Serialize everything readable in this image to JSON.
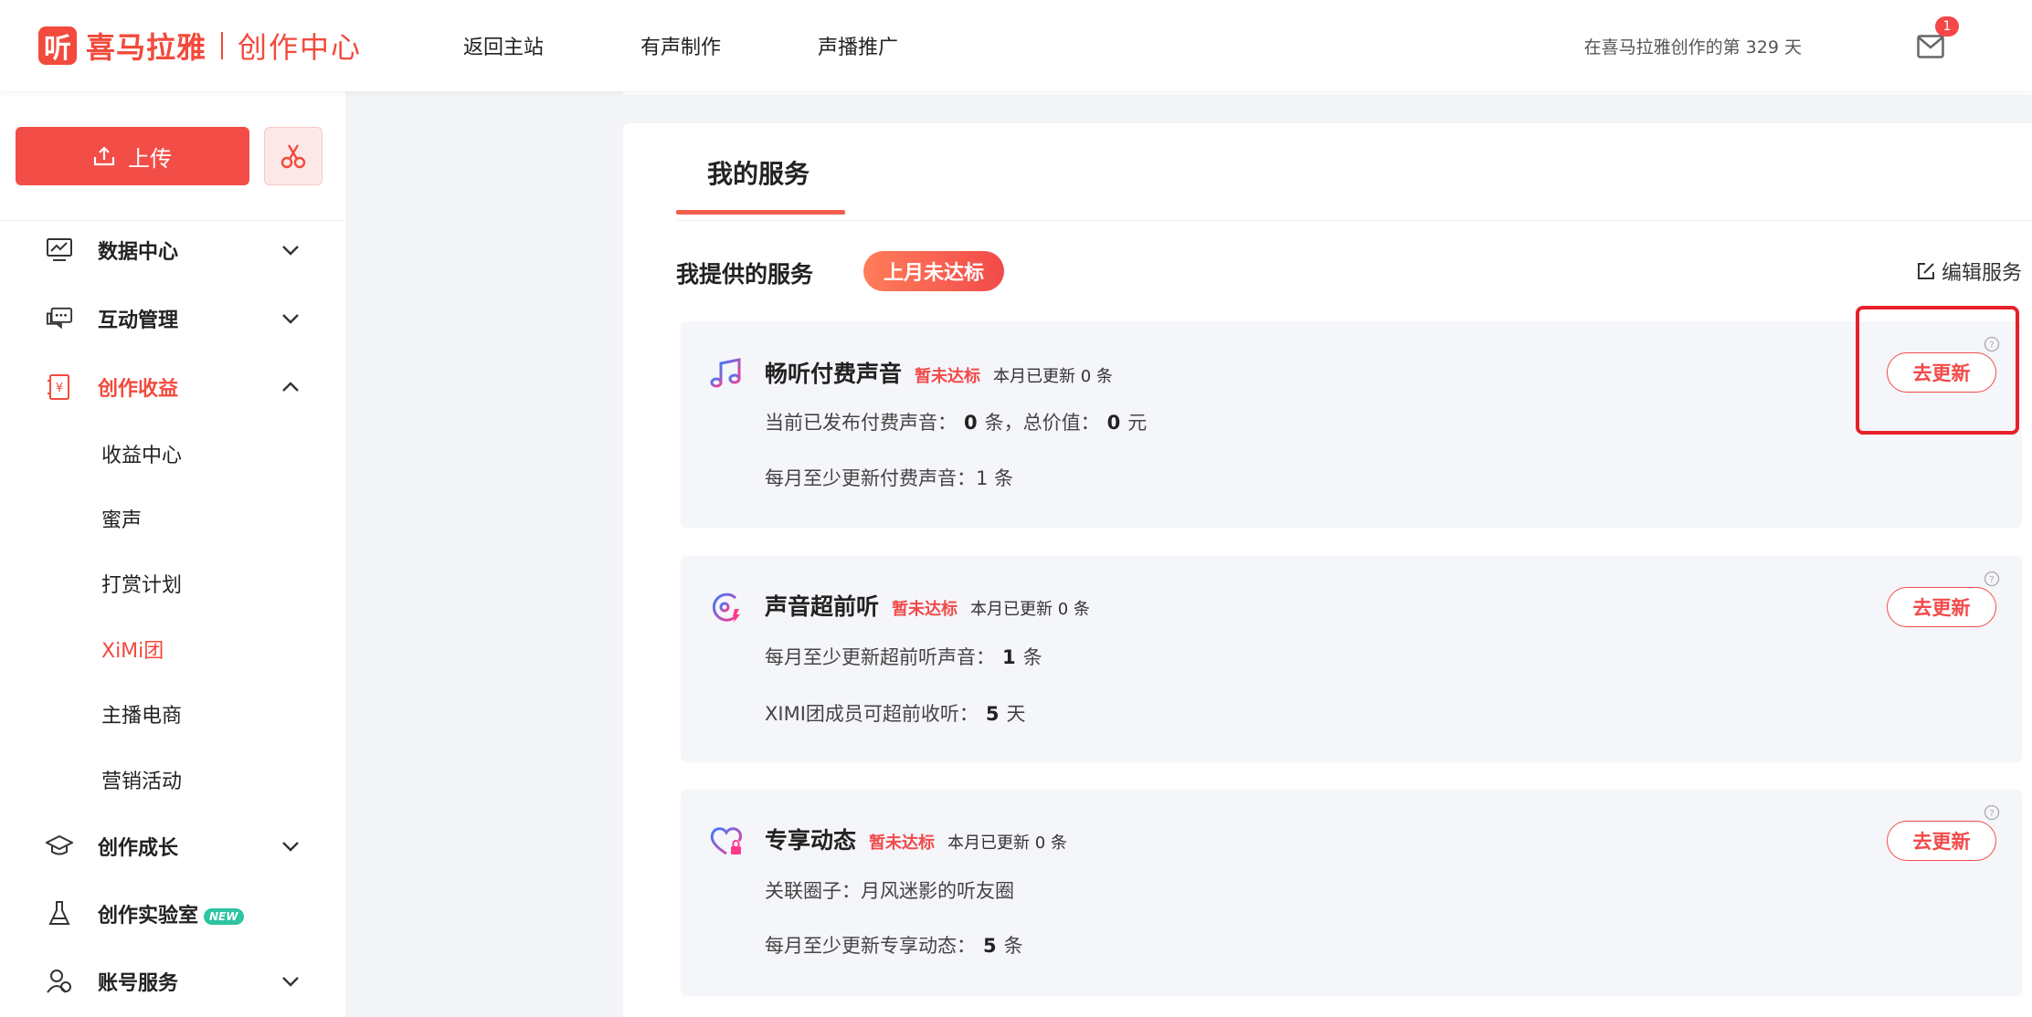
{
  "brand": {
    "logo_mark": "听",
    "logo_text": "喜马拉雅",
    "logo_sub": "创作中心"
  },
  "topnav": [
    "返回主站",
    "有声制作",
    "声播推广"
  ],
  "header": {
    "days_text": "在喜马拉雅创作的第 329 天",
    "mail_badge": "1"
  },
  "sidebar": {
    "upload_label": "上传",
    "menu": [
      {
        "label": "数据中心"
      },
      {
        "label": "互动管理"
      },
      {
        "label": "创作收益"
      },
      {
        "label": "创作成长"
      },
      {
        "label": "创作实验室",
        "badge": "NEW"
      },
      {
        "label": "账号服务"
      }
    ],
    "submenu": [
      "收益中心",
      "蜜声",
      "打赏计划",
      "XiMi团",
      "主播电商",
      "营销活动"
    ]
  },
  "main": {
    "tab_title": "我的服务",
    "section_title": "我提供的服务",
    "section_badge": "上月未达标",
    "edit_label": "编辑服务",
    "cards": [
      {
        "title": "畅听付费声音",
        "status": "暂未达标",
        "count": "本月已更新 0 条",
        "line1_prefix": "当前已发布付费声音：",
        "line1_v1": "0",
        "line1_mid": "条，总价值：",
        "line1_v2": "0",
        "line1_suffix": "元",
        "line2_prefix": "每月至少更新付费声音：",
        "line2_value": "1 条",
        "button": "去更新"
      },
      {
        "title": "声音超前听",
        "status": "暂未达标",
        "count": "本月已更新 0 条",
        "line1_prefix": "每月至少更新超前听声音：",
        "line1_value": "1",
        "line1_suffix": "条",
        "line2_prefix": "XIMI团成员可超前收听：",
        "line2_value": "5",
        "line2_suffix": "天",
        "button": "去更新"
      },
      {
        "title": "专享动态",
        "status": "暂未达标",
        "count": "本月已更新 0 条",
        "line1_prefix": "关联圈子：月风迷影的听友圈",
        "line2_prefix": "每月至少更新专享动态：",
        "line2_value": "5",
        "line2_suffix": "条",
        "button": "去更新"
      }
    ]
  },
  "colors": {
    "accent": "#f24a3c",
    "highlight": "#e8202a",
    "new_badge": "#2cc4a1"
  }
}
